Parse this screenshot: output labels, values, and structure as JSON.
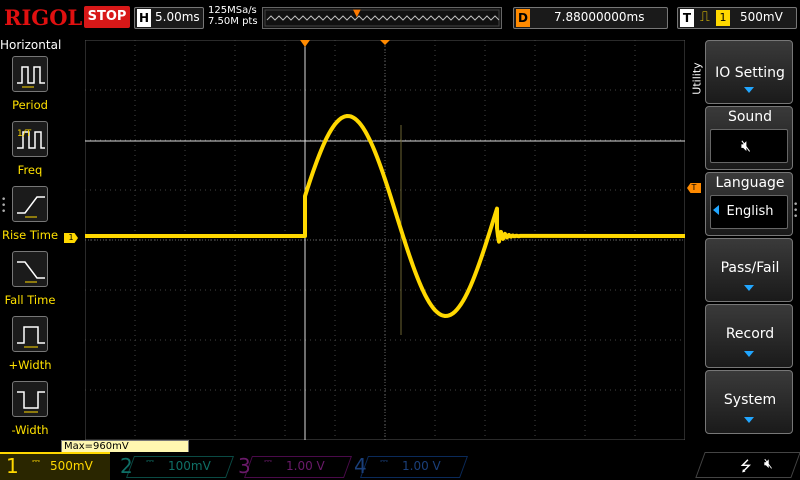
{
  "topbar": {
    "brand": "RIGOL",
    "run_state": "STOP",
    "horizontal_label": "H",
    "timebase": "5.00ms",
    "sample_rate": "125MSa/s",
    "memory_depth": "7.50M pts",
    "delay_label": "D",
    "delay_value": "7.88000000ms",
    "trigger_label": "T",
    "trigger_edge_icon": "rising-edge-icon",
    "trigger_source": "1",
    "trigger_level": "500mV"
  },
  "left_panel": {
    "title": "Horizontal",
    "items": [
      {
        "label": "Period",
        "icon": "period-icon"
      },
      {
        "label": "Freq",
        "icon": "frequency-icon"
      },
      {
        "label": "Rise Time",
        "icon": "rise-time-icon"
      },
      {
        "label": "Fall Time",
        "icon": "fall-time-icon"
      },
      {
        "label": "+Width",
        "icon": "positive-width-icon"
      },
      {
        "label": "-Width",
        "icon": "negative-width-icon"
      }
    ]
  },
  "right_panel": {
    "tab_label": "Utility",
    "menu": [
      {
        "label": "IO Setting",
        "has_arrow": true
      },
      {
        "label": "Sound",
        "value_icon": "speaker-mute-icon"
      },
      {
        "label": "Language",
        "value": "English"
      },
      {
        "label": "Pass/Fail",
        "has_arrow": true
      },
      {
        "label": "Record",
        "has_arrow": true
      },
      {
        "label": "System",
        "has_arrow": true
      }
    ]
  },
  "screen": {
    "channel_marker": "1",
    "trigger_marker": "T",
    "measurement": "Max=960mV"
  },
  "channels": [
    {
      "num": "1",
      "scale": "500mV",
      "color": "#ffd800",
      "active": true
    },
    {
      "num": "2",
      "scale": "100mV",
      "color": "#00c1b0",
      "active": false
    },
    {
      "num": "3",
      "scale": "1.00 V",
      "color": "#e000e0",
      "active": false
    },
    {
      "num": "4",
      "scale": "1.00 V",
      "color": "#1e6bff",
      "active": false
    }
  ],
  "status_icons": [
    "usb-icon",
    "speaker-mute-icon"
  ],
  "colors": {
    "ch1": "#ffd800",
    "trigger": "#ff8a00",
    "stop": "#d81818",
    "brand": "#e01010",
    "menu_arrow": "#21a6ff"
  }
}
